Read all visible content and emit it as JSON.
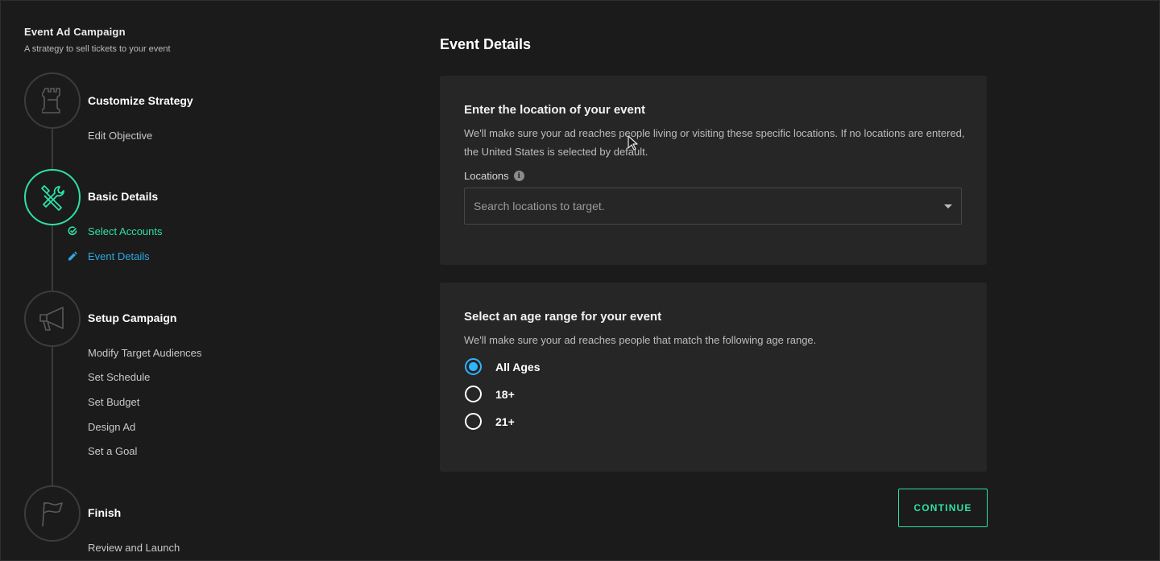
{
  "campaign": {
    "title": "Event Ad Campaign",
    "subtitle": "A strategy to sell tickets to your event"
  },
  "steps": [
    {
      "title": "Customize Strategy",
      "icon": "chess-rook-icon",
      "items": [
        {
          "label": "Edit Objective",
          "state": "default"
        }
      ]
    },
    {
      "title": "Basic Details",
      "icon": "tools-icon",
      "active": true,
      "items": [
        {
          "label": "Select Accounts",
          "state": "done"
        },
        {
          "label": "Event Details",
          "state": "current"
        }
      ]
    },
    {
      "title": "Setup Campaign",
      "icon": "megaphone-icon",
      "items": [
        {
          "label": "Modify Target Audiences",
          "state": "default"
        },
        {
          "label": "Set Schedule",
          "state": "default"
        },
        {
          "label": "Set Budget",
          "state": "default"
        },
        {
          "label": "Design Ad",
          "state": "default"
        },
        {
          "label": "Set a Goal",
          "state": "default"
        }
      ]
    },
    {
      "title": "Finish",
      "icon": "flag-icon",
      "items": [
        {
          "label": "Review and Launch",
          "state": "default"
        }
      ]
    }
  ],
  "main": {
    "title": "Event Details",
    "location_card": {
      "heading": "Enter the location of your event",
      "description": "We'll make sure your ad reaches people living or visiting these specific locations. If no locations are entered, the United States is selected by default.",
      "field_label": "Locations",
      "placeholder": "Search locations to target.",
      "value": ""
    },
    "age_card": {
      "heading": "Select an age range for your event",
      "description": "We'll make sure your ad reaches people that match the following age range.",
      "options": [
        {
          "label": "All Ages",
          "selected": true
        },
        {
          "label": "18+",
          "selected": false
        },
        {
          "label": "21+",
          "selected": false
        }
      ]
    },
    "continue_label": "CONTINUE"
  },
  "colors": {
    "background": "#1b1b1b",
    "card": "#262626",
    "accent_green": "#2ee0a8",
    "accent_blue": "#2ea8e0",
    "radio_selected": "#2eb4ff"
  }
}
